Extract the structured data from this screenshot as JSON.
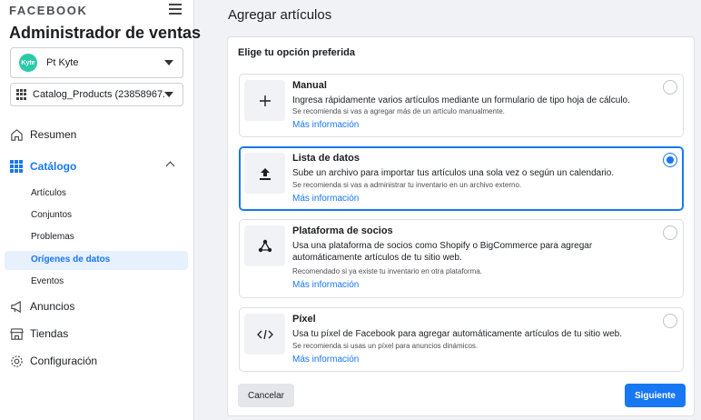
{
  "sidebar": {
    "brand": "FACEBOOK",
    "title": "Administrador de ventas",
    "account": {
      "logo_text": "Kyte",
      "name": "Pt Kyte"
    },
    "catalog": {
      "name": "Catalog_Products (23858967..."
    },
    "nav": {
      "resumen": "Resumen",
      "catalogo": "Catálogo",
      "anuncios": "Anuncios",
      "tiendas": "Tiendas",
      "configuracion": "Configuración"
    },
    "sub": [
      "Artículos",
      "Conjuntos",
      "Problemas",
      "Orígenes de datos",
      "Eventos"
    ]
  },
  "main": {
    "title": "Agregar artículos",
    "subtitle": "Elige tu opción preferida",
    "options": [
      {
        "title": "Manual",
        "desc": "Ingresa rápidamente varios artículos mediante un formulario de tipo hoja de cálculo.",
        "note": "Se recomienda si vas a agregar más de un artículo manualmente.",
        "link": "Más información",
        "icon": "plus-icon",
        "selected": false
      },
      {
        "title": "Lista de datos",
        "desc": "Sube un archivo para importar tus artículos una sola vez o según un calendario.",
        "note": "Se recomienda si vas a administrar tu inventario en un archivo externo.",
        "link": "Más información",
        "icon": "upload-icon",
        "selected": true
      },
      {
        "title": "Plataforma de socios",
        "desc": "Usa una plataforma de socios como Shopify o BigCommerce para agregar automáticamente artículos de tu sitio web.",
        "note": "Recomendado si ya existe tu inventario en otra plataforma.",
        "link": "Más información",
        "icon": "share-nodes-icon",
        "selected": false
      },
      {
        "title": "Píxel",
        "desc": "Usa tu píxel de Facebook para agregar automáticamente artículos de tu sitio web.",
        "note": "Se recomienda si usas un píxel para anuncios dinámicos.",
        "link": "Más información",
        "icon": "code-icon",
        "selected": false
      }
    ],
    "cancel_label": "Cancelar",
    "next_label": "Siguiente"
  },
  "colors": {
    "accent": "#1877f2",
    "background": "#f0f2f5",
    "kyte": "#2dc8a8"
  }
}
